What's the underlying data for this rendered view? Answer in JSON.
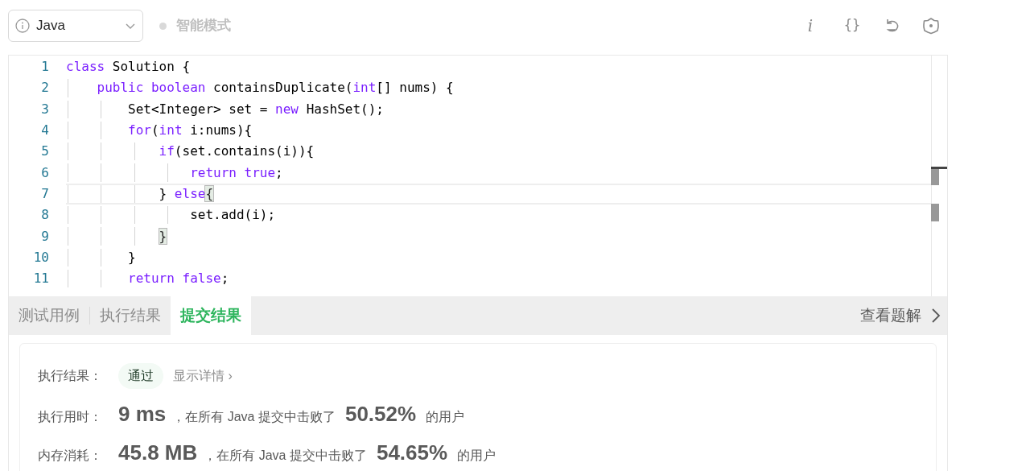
{
  "toolbar": {
    "language": "Java",
    "mode": "智能模式",
    "mode_on": false,
    "icons": [
      "i",
      "{}"
    ]
  },
  "editor": {
    "lines": [
      {
        "number": "1",
        "current": false,
        "tokens": [
          {
            "kind": "kw",
            "text": "class"
          },
          {
            "kind": "plain",
            "text": " Solution {"
          }
        ]
      },
      {
        "number": "2",
        "current": false,
        "tokens": [
          {
            "kind": "kw",
            "text": "    public"
          },
          {
            "kind": "kw",
            "text": " boolean"
          },
          {
            "kind": "plain",
            "text": " containsDuplicate("
          },
          {
            "kind": "kw",
            "text": "int"
          },
          {
            "kind": "plain",
            "text": "[] nums) {"
          }
        ]
      },
      {
        "number": "3",
        "current": false,
        "tokens": [
          {
            "kind": "plain",
            "text": "        Set<Integer> set = "
          },
          {
            "kind": "kw",
            "text": "new"
          },
          {
            "kind": "plain",
            "text": " HashSet();"
          }
        ]
      },
      {
        "number": "4",
        "current": false,
        "tokens": [
          {
            "kind": "kw",
            "text": "        for"
          },
          {
            "kind": "plain",
            "text": "("
          },
          {
            "kind": "kw",
            "text": "int"
          },
          {
            "kind": "plain",
            "text": " i:nums){"
          }
        ]
      },
      {
        "number": "5",
        "current": false,
        "tokens": [
          {
            "kind": "kw",
            "text": "            if"
          },
          {
            "kind": "plain",
            "text": "(set.contains(i)){"
          }
        ]
      },
      {
        "number": "6",
        "current": false,
        "tokens": [
          {
            "kind": "kw",
            "text": "                return"
          },
          {
            "kind": "kw",
            "text": " true"
          },
          {
            "kind": "plain",
            "text": ";"
          }
        ]
      },
      {
        "number": "7",
        "current": true,
        "tokens": [
          {
            "kind": "plain",
            "text": "            } "
          },
          {
            "kind": "kw",
            "text": "else"
          },
          {
            "kind": "match",
            "text": "{"
          }
        ]
      },
      {
        "number": "8",
        "current": false,
        "tokens": [
          {
            "kind": "plain",
            "text": "                set.add(i);"
          }
        ]
      },
      {
        "number": "9",
        "current": false,
        "tokens": [
          {
            "kind": "match",
            "text": "            }"
          }
        ]
      },
      {
        "number": "10",
        "current": false,
        "tokens": [
          {
            "kind": "plain",
            "text": "        }"
          }
        ]
      },
      {
        "number": "11",
        "current": false,
        "tokens": [
          {
            "kind": "kw",
            "text": "        return"
          },
          {
            "kind": "kw",
            "text": " false"
          },
          {
            "kind": "plain",
            "text": ";"
          }
        ]
      }
    ]
  },
  "tabs": [
    {
      "label": "测试用例",
      "selected": false
    },
    {
      "label": "执行结果",
      "selected": false
    },
    {
      "label": "提交结果",
      "selected": true
    }
  ],
  "solution_link": "查看题解",
  "result": {
    "label": "执行结果：",
    "status": "通过",
    "details": "显示详情 ›",
    "stats": [
      {
        "label": "执行用时：",
        "value": "9 ms",
        "middle": "，在所有 Java 提交中击败了",
        "percent": "50.52%",
        "suffix": "的用户"
      },
      {
        "label": "内存消耗：",
        "value": "45.8 MB",
        "middle": "，在所有 Java 提交中击败了",
        "percent": "54.65%",
        "suffix": "的用户"
      }
    ]
  }
}
